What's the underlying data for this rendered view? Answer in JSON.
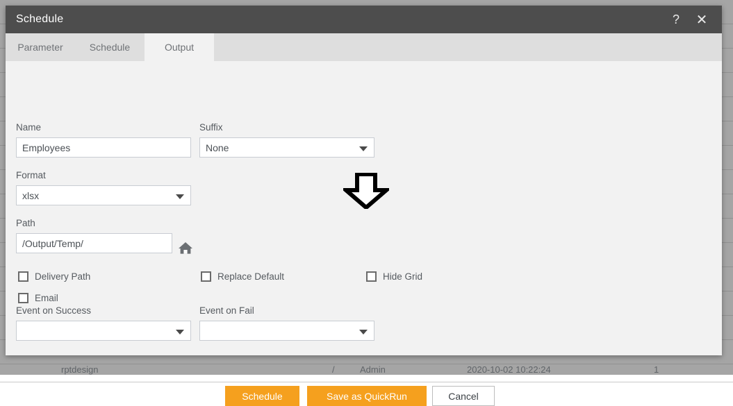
{
  "background": {
    "row": {
      "name": "rptdesign",
      "path": "/",
      "owner": "Admin",
      "modified": "2020-10-02 10:22:24",
      "count": "1"
    }
  },
  "dialog": {
    "title": "Schedule",
    "help_icon": "question-mark-icon",
    "close_icon": "close-icon",
    "tabs": [
      {
        "label": "Parameter",
        "active": false
      },
      {
        "label": "Schedule",
        "active": false
      },
      {
        "label": "Output",
        "active": true
      }
    ],
    "fields": {
      "name_label": "Name",
      "name_value": "Employees",
      "suffix_label": "Suffix",
      "suffix_value": "None",
      "format_label": "Format",
      "format_value": "xlsx",
      "path_label": "Path",
      "path_value": "/Output/Temp/",
      "home_icon": "home-icon",
      "event_success_label": "Event on Success",
      "event_success_value": "",
      "event_fail_label": "Event on Fail",
      "event_fail_value": ""
    },
    "checkboxes": [
      {
        "label": "Delivery Path",
        "checked": false
      },
      {
        "label": "Email",
        "checked": false
      },
      {
        "label": "Replace Default",
        "checked": false
      },
      {
        "label": "Hide Grid",
        "checked": false
      }
    ],
    "buttons": {
      "schedule": "Schedule",
      "quickrun": "Save as QuickRun",
      "cancel": "Cancel"
    }
  },
  "annotation": {
    "arrow_icon": "down-arrow-annotation",
    "points_at": "Hide Grid"
  },
  "colors": {
    "accent": "#f5a01e",
    "titlebar": "#4d4d4d",
    "tabbar": "#dedede",
    "panel": "#f2f2f2"
  }
}
